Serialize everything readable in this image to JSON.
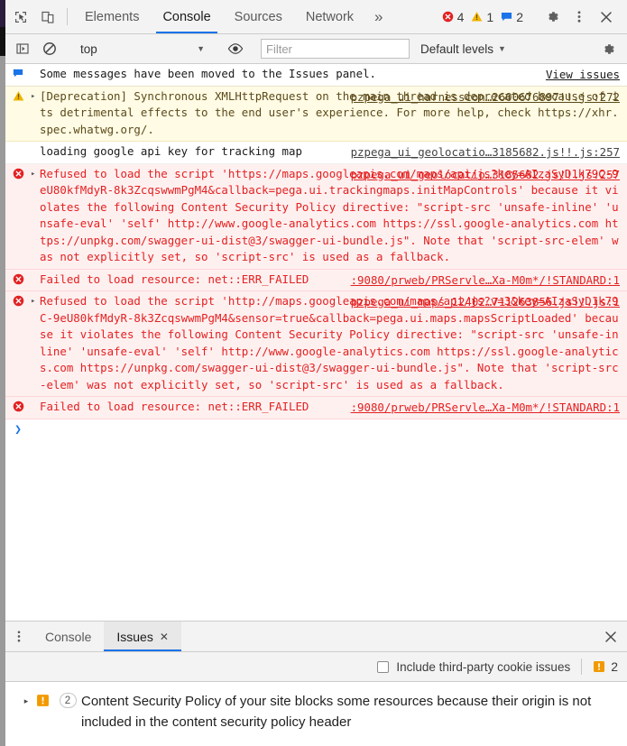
{
  "window": {
    "title": "Chrome DevTools - Console"
  },
  "top_toolbar": {
    "icons": [
      {
        "name": "inspect-element-icon",
        "label": "Inspect element"
      },
      {
        "name": "device-toolbar-icon",
        "label": "Toggle device toolbar"
      }
    ],
    "tabs": [
      {
        "label": "Elements",
        "active": false
      },
      {
        "label": "Console",
        "active": true
      },
      {
        "label": "Sources",
        "active": false
      },
      {
        "label": "Network",
        "active": false
      }
    ],
    "more_tabs_label": "»",
    "error_count": "4",
    "warning_count": "1",
    "info_count": "2",
    "settings_label": "Settings",
    "kebab_label": "Customize and control DevTools",
    "close_label": "Close DevTools",
    "colors": {
      "error": "#e32121",
      "warning": "#f0b400",
      "info": "#1a73e8",
      "accent": "#1a73e8"
    }
  },
  "console_toolbar": {
    "clear_console_label": "Clear console",
    "no_entry_label": "No entry",
    "context": "top",
    "context_caret": "▼",
    "eye_label": "Create live expression",
    "filter_placeholder": "Filter",
    "filter_value": "",
    "levels_label": "Default levels",
    "levels_caret": "▼",
    "settings_label": "Console settings"
  },
  "console_messages": [
    {
      "type": "info-bar",
      "icon": "info-icon",
      "expandable": false,
      "text": "Some messages have been moved to the Issues panel.",
      "link": "View issues",
      "link_kind": "viewissues"
    },
    {
      "type": "warn",
      "icon": "warning-icon",
      "expandable": true,
      "text": "[Deprecation] Synchronous XMLHttpRequest on the main thread is deprecated because of its detrimental effects to the end user's experience. For more help, check https://xhr.spec.whatwg.org/.",
      "source": "pzpega_ui_harnesscon…2600676897!!.js:272"
    },
    {
      "type": "log",
      "icon": "none",
      "expandable": false,
      "text": "loading google api key for tracking map",
      "source": "pzpega_ui_geolocatio…3185682.js!!.js:257"
    },
    {
      "type": "err",
      "icon": "error-icon",
      "expandable": true,
      "text": "Refused to load the script 'https://maps.googleapis.com/maps/api/js?key=AIzaSyD1k79C-9eU80kfMdyR-8k3ZcqswwmPgM4&callback=pega.ui.trackingmaps.initMapControls' because it violates the following Content Security Policy directive: \"script-src 'unsafe-inline' 'unsafe-eval' 'self' http://www.google-analytics.com https://ssl.google-analytics.com https://unpkg.com/swagger-ui-dist@3/swagger-ui-bundle.js\". Note that 'script-src-elem' was not explicitly set, so 'script-src' is used as a fallback.",
      "source": "pzpega_ui_geolocatio…3185682.js!!.js:257"
    },
    {
      "type": "err",
      "icon": "error-icon",
      "expandable": false,
      "text": "Failed to load resource: net::ERR_FAILED",
      "source": ":9080/prweb/PRServle…Xa-M0m*/!STANDARD:1"
    },
    {
      "type": "err",
      "icon": "error-icon",
      "expandable": true,
      "text": "Refused to load the script 'http://maps.googleapis.com/maps/api/js?v=3&key=AIzaSyD1k79C-9eU80kfMdyR-8k3ZcqswwmPgM4&sensor=true&callback=pega.ui.maps.mapsScriptLoaded' because it violates the following Content Security Policy directive: \"script-src 'unsafe-inline' 'unsafe-eval' 'self' http://www.google-analytics.com https://ssl.google-analytics.com https://unpkg.com/swagger-ui-dist@3/swagger-ui-bundle.js\". Note that 'script-src-elem' was not explicitly set, so 'script-src' is used as a fallback.",
      "source": "pzpega_ui_maps_12402…711263856.js!!.js:1"
    },
    {
      "type": "err",
      "icon": "error-icon",
      "expandable": false,
      "text": "Failed to load resource: net::ERR_FAILED",
      "source": ":9080/prweb/PRServle…Xa-M0m*/!STANDARD:1"
    }
  ],
  "console_prompt": {
    "chevron": "❯",
    "value": ""
  },
  "drawer": {
    "kebab_label": "More tools",
    "tabs": [
      {
        "label": "Console",
        "active": false,
        "closable": false
      },
      {
        "label": "Issues",
        "active": true,
        "closable": true,
        "close_glyph": "✕"
      }
    ],
    "close_glyph": "✕",
    "close_label": "Close drawer",
    "cookie_checkbox_label": "Include third-party cookie issues",
    "cookie_checkbox_checked": false,
    "issue_count": "2",
    "issues": [
      {
        "triangle": "▸",
        "severity": "warning-badge-icon",
        "count": "2",
        "title": "Content Security Policy of your site blocks some resources because their origin is not included in the content security policy header"
      }
    ]
  }
}
